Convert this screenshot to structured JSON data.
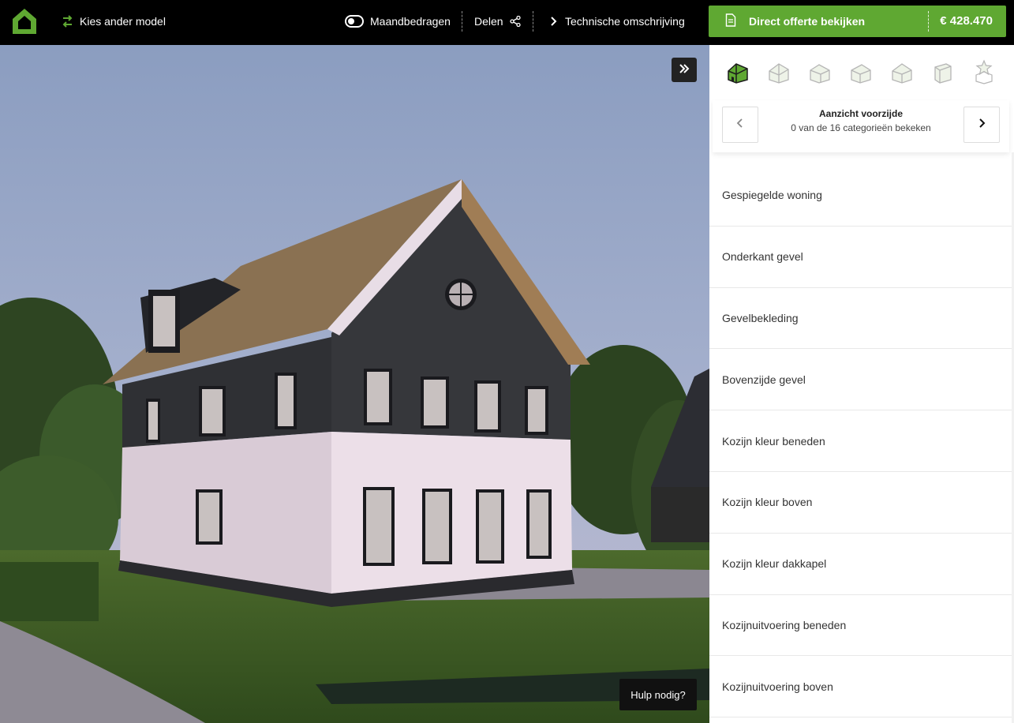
{
  "header": {
    "logo_icon": "house-logo-icon",
    "change_model_label": "Kies ander model",
    "monthly_toggle_label": "Maandbedragen",
    "share_label": "Delen",
    "tech_description_label": "Technische omschrijving",
    "cta_label": "Direct offerte bekijken",
    "price": "€ 428.470"
  },
  "colors": {
    "brand_green": "#5fa832",
    "topbar_bg": "#000000"
  },
  "viewer": {
    "help_label": "Hulp nodig?"
  },
  "sidebar": {
    "views": [
      {
        "icon": "house-front-view-icon",
        "active": true
      },
      {
        "icon": "house-side-view-icon",
        "active": false
      },
      {
        "icon": "house-back-view-icon",
        "active": false
      },
      {
        "icon": "house-side-view-2-icon",
        "active": false
      },
      {
        "icon": "house-roof-view-icon",
        "active": false
      },
      {
        "icon": "interior-view-icon",
        "active": false
      },
      {
        "icon": "extras-star-icon",
        "active": false
      }
    ],
    "nav": {
      "title": "Aanzicht voorzijde",
      "subtitle": "0 van de 16 categorieën bekeken"
    },
    "categories": [
      "Gespiegelde woning",
      "Onderkant gevel",
      "Gevelbekleding",
      "Bovenzijde gevel",
      "Kozijn kleur beneden",
      "Kozijn kleur boven",
      "Kozijn kleur dakkapel",
      "Kozijnuitvoering beneden",
      "Kozijnuitvoering boven"
    ]
  }
}
